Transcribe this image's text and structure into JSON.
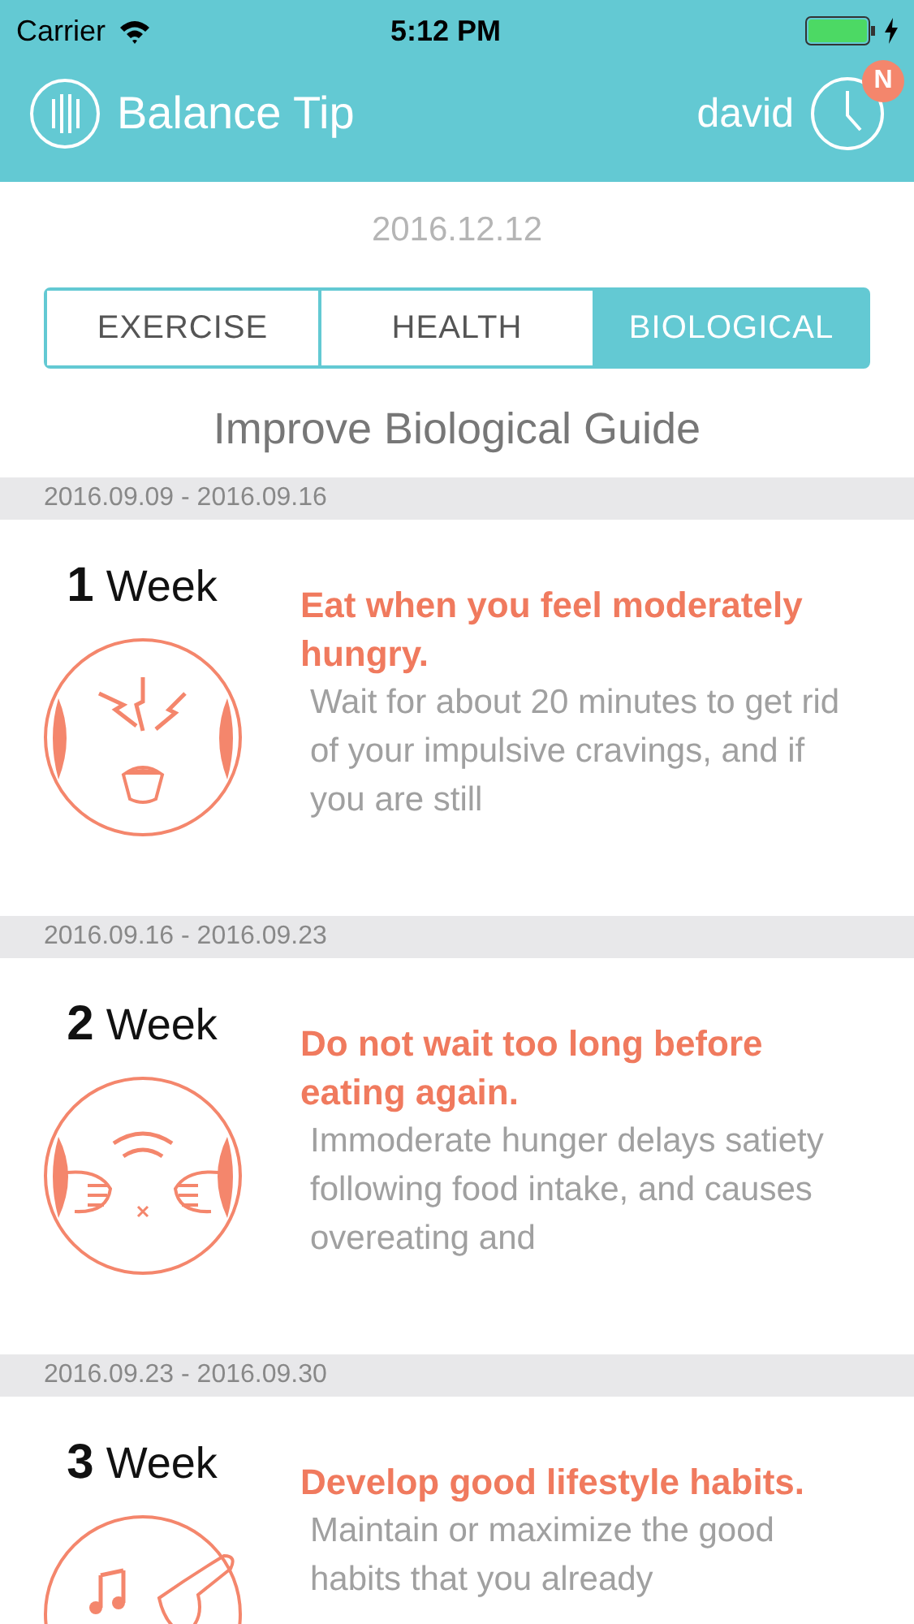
{
  "status_bar": {
    "carrier": "Carrier",
    "time": "5:12 PM"
  },
  "header": {
    "title": "Balance Tip",
    "user": "david",
    "badge": "N"
  },
  "date": "2016.12.12",
  "tabs": [
    {
      "label": "EXERCISE",
      "selected": false
    },
    {
      "label": "HEALTH",
      "selected": false
    },
    {
      "label": "BIOLOGICAL",
      "selected": true
    }
  ],
  "heading": "Improve Biological Guide",
  "weeks": [
    {
      "range": "2016.09.09 - 2016.09.16",
      "number": "1",
      "unit": "Week",
      "kind": "hungry",
      "title": "Eat when you feel moderately hungry.",
      "body": "Wait for about 20 minutes to get rid of your impulsive cravings, and if you are still"
    },
    {
      "range": "2016.09.16 - 2016.09.23",
      "number": "2",
      "unit": "Week",
      "kind": "belly",
      "title": "Do not wait too long before eating again.",
      "body": "Immoderate hunger delays satiety following food intake, and causes overeating and"
    },
    {
      "range": "2016.09.23 - 2016.09.30",
      "number": "3",
      "unit": "Week",
      "kind": "music",
      "title": "Develop good lifestyle habits.",
      "body": "Maintain or maximize the good habits that you already"
    }
  ]
}
